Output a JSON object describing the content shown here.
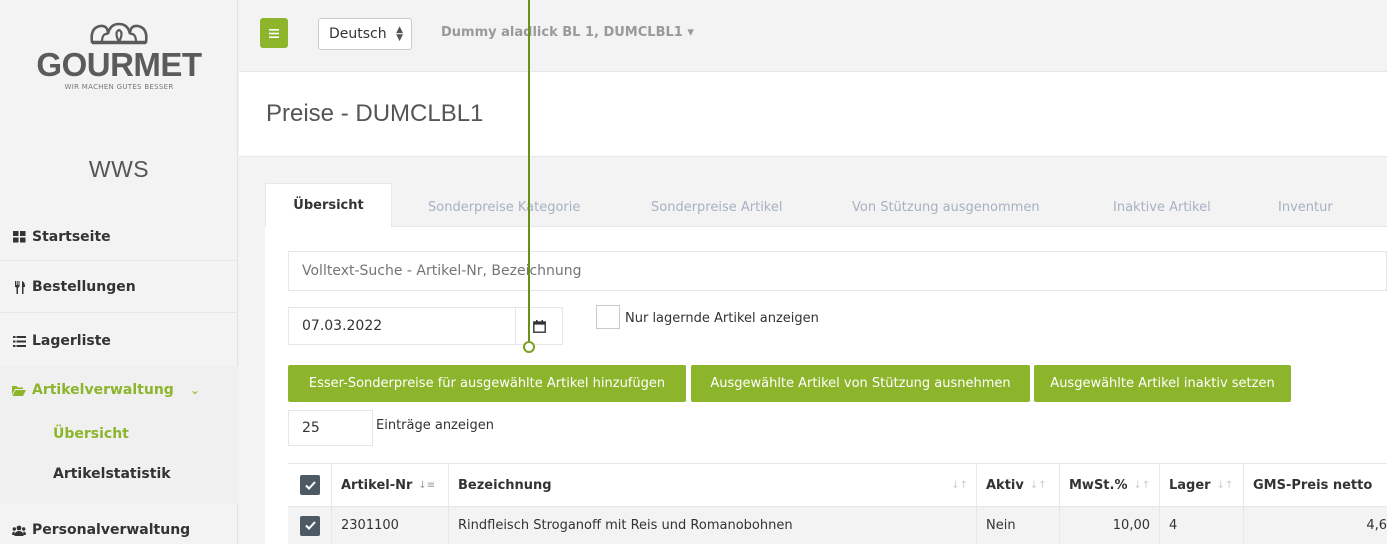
{
  "brand": {
    "name": "GOURMET",
    "tagline": "WIR MACHEN GUTES BESSER",
    "app": "WWS"
  },
  "sidebar": {
    "items": [
      {
        "label": "Startseite",
        "icon": "grid-icon"
      },
      {
        "label": "Bestellungen",
        "icon": "cutlery-icon"
      },
      {
        "label": "Lagerliste",
        "icon": "list-icon"
      },
      {
        "label": "Artikelverwaltung",
        "icon": "folder-open-icon"
      },
      {
        "label": "Personalverwaltung",
        "icon": "users-icon"
      }
    ],
    "sub_items": [
      {
        "label": "Übersicht"
      },
      {
        "label": "Artikelstatistik"
      }
    ]
  },
  "topbar": {
    "language": "Deutsch",
    "tenant": "Dummy aladlick BL 1, DUMCLBL1 ▾"
  },
  "page": {
    "title": "Preise - DUMCLBL1"
  },
  "tabs": [
    {
      "label": "Übersicht",
      "active": true
    },
    {
      "label": "Sonderpreise Kategorie"
    },
    {
      "label": "Sonderpreise Artikel"
    },
    {
      "label": "Von Stützung ausgenommen"
    },
    {
      "label": "Inaktive Artikel"
    },
    {
      "label": "Inventur"
    }
  ],
  "search": {
    "placeholder": "Volltext-Suche - Artikel-Nr, Bezeichnung"
  },
  "filters": {
    "date": "07.03.2022",
    "only_stock_label": "Nur lagernde Artikel anzeigen"
  },
  "actions": {
    "add_special": "Esser-Sonderpreise für ausgewählte Artikel hinzufügen",
    "exclude": "Ausgewählte Artikel von Stützung ausnehmen",
    "inactive": "Ausgewählte Artikel inaktiv setzen"
  },
  "page_length": {
    "value": "25",
    "label": "Einträge anzeigen"
  },
  "table": {
    "columns": [
      "Artikel-Nr",
      "Bezeichnung",
      "Aktiv",
      "MwSt.%",
      "Lager",
      "GMS-Preis netto"
    ],
    "rows": [
      {
        "artikel_nr": "2301100",
        "bezeichnung": "Rindfleisch Stroganoff mit Reis und Romanobohnen",
        "aktiv": "Nein",
        "mwst": "10,00",
        "lager": "4",
        "gms_preis": "4,6"
      }
    ]
  },
  "colors": {
    "accent": "#8cb52b",
    "checkbox": "#4d5a63"
  }
}
